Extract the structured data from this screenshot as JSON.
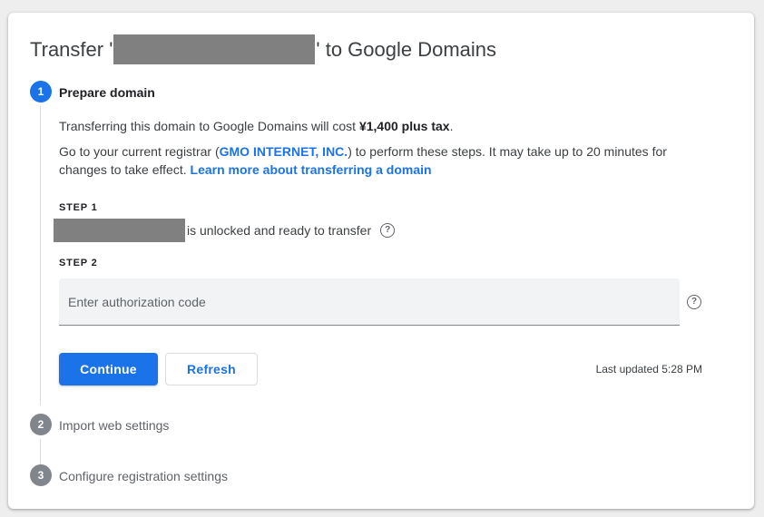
{
  "dialog": {
    "title_prefix": "Transfer '",
    "title_suffix": "' to Google Domains"
  },
  "steps": [
    {
      "number": "1",
      "label": "Prepare domain"
    },
    {
      "number": "2",
      "label": "Import web settings"
    },
    {
      "number": "3",
      "label": "Configure registration settings"
    }
  ],
  "prepare": {
    "cost_text": "Transferring this domain to Google Domains will cost ",
    "cost_amount": "¥1,400 plus tax",
    "cost_end": ".",
    "registrar_pre": "Go to your current registrar (",
    "registrar_name": "GMO INTERNET, INC.",
    "registrar_post": ") to perform these steps. It may take up to 20 minutes for",
    "line2_pre": "changes to take effect. ",
    "learn_more": "Learn more about transferring a domain",
    "step1_label": "STEP 1",
    "unlocked_text": "is unlocked and ready to transfer",
    "step2_label": "STEP 2",
    "auth_placeholder": "Enter authorization code",
    "continue_label": "Continue",
    "refresh_label": "Refresh",
    "last_updated": "Last updated 5:28 PM"
  },
  "icons": {
    "help": "help-circle-icon"
  },
  "colors": {
    "accent": "#1a73e8",
    "inactive_step": "#80868b",
    "redaction": "#808080"
  }
}
